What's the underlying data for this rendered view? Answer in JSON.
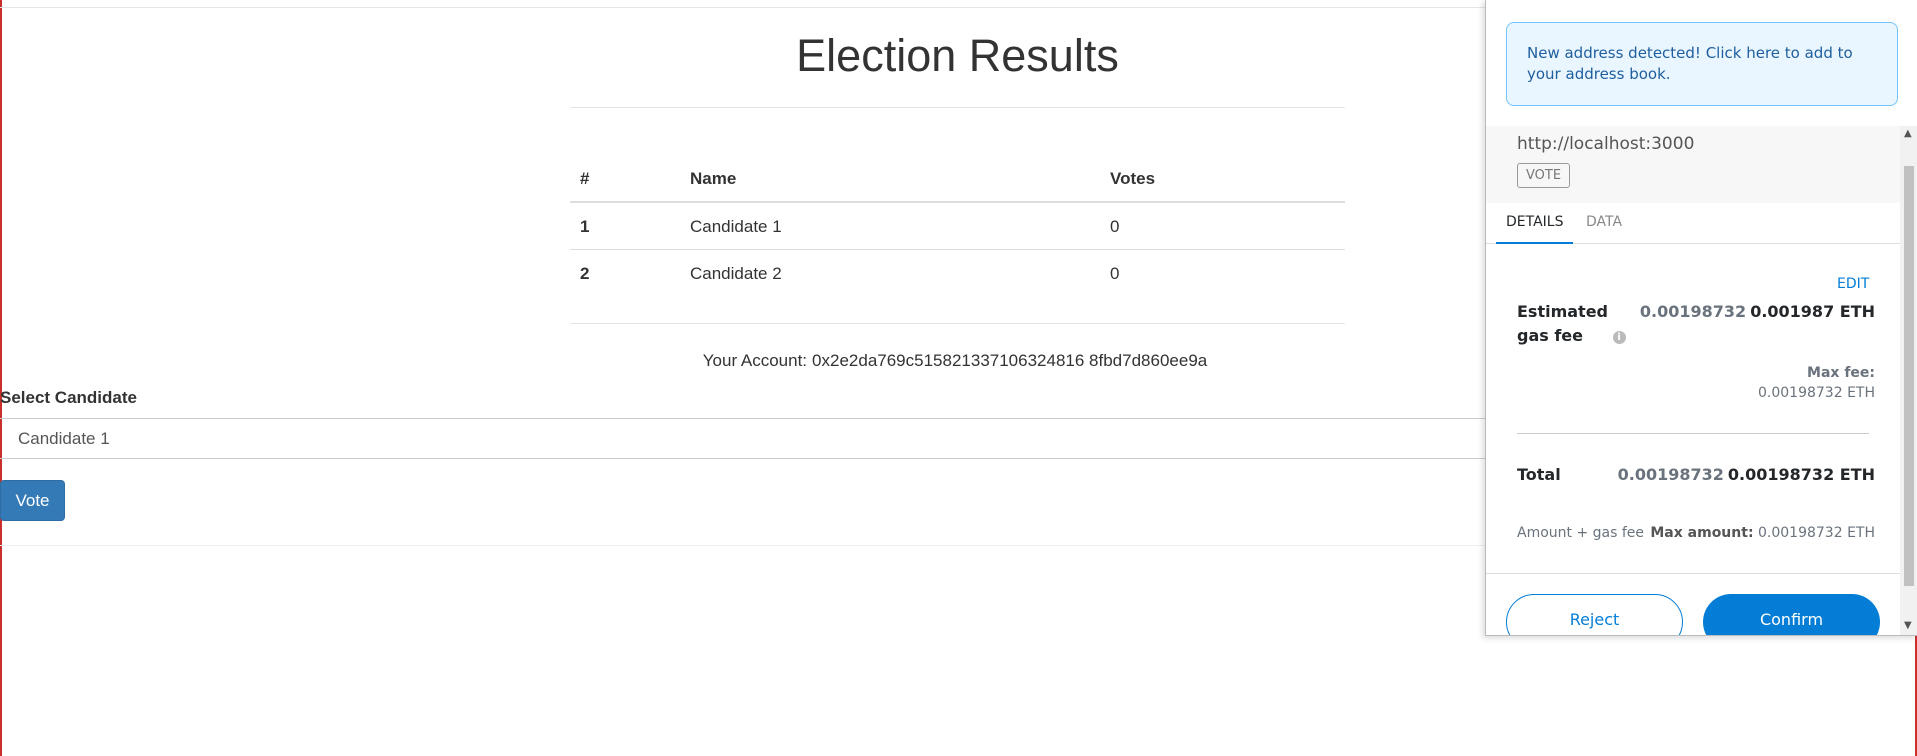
{
  "page": {
    "title": "Election Results",
    "table_headers": [
      "#",
      "Name",
      "Votes"
    ],
    "candidates": [
      {
        "id": "1",
        "name": "Candidate 1",
        "votes": "0"
      },
      {
        "id": "2",
        "name": "Candidate 2",
        "votes": "0"
      }
    ],
    "account_label": "Your Account:",
    "account_address": "0x2e2da769c515821337106324816 8fbd7d860ee9a",
    "select_label": "Select Candidate",
    "select_value": "Candidate 1",
    "vote_button": "Vote"
  },
  "metamask": {
    "notice": "New address detected! Click here to add to your address book.",
    "origin": "http://localhost:3000",
    "method": "VOTE",
    "tabs": [
      "DETAILS",
      "DATA"
    ],
    "active_tab": "DETAILS",
    "edit": "EDIT",
    "gas_label": "Estimated gas fee",
    "gas_secondary": "0.00198732",
    "gas_primary": "0.001987 ETH",
    "max_fee_label": "Max fee:",
    "max_fee_value": "0.00198732 ETH",
    "total_label": "Total",
    "total_secondary": "0.00198732",
    "total_primary": "0.00198732 ETH",
    "amount_gas_label": "Amount + gas fee",
    "max_amount_label": "Max amount:",
    "max_amount_value": "0.00198732 ETH",
    "reject_button": "Reject",
    "confirm_button": "Confirm"
  },
  "colors": {
    "primary_button": "#337ab7",
    "metamask_blue": "#037dd6",
    "frame_red": "#c9302c"
  }
}
